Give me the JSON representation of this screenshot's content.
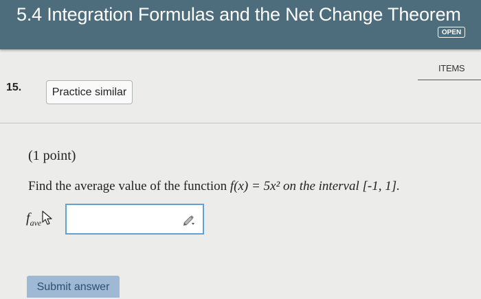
{
  "header": {
    "title": "5.4 Integration Formulas and the Net Change Theorem",
    "badge": "OPEN"
  },
  "nav": {
    "items_label": "ITEMS"
  },
  "question": {
    "number": "15.",
    "practice_label": "Practice similar",
    "points": "(1 point)",
    "text_before": "Find the average value of the function ",
    "function_expr": "f(x) = 5x² on the interval [-1, 1].",
    "answer_label_f": "f",
    "answer_label_sub": "ave",
    "answer_label_eq": "=",
    "answer_value": ""
  },
  "submit": {
    "label": "Submit answer"
  },
  "icons": {
    "pencil": "pencil-icon",
    "cursor": "mouse-cursor-icon"
  },
  "colors": {
    "header_bg": "#4d6d7d",
    "input_border": "#5da1d6",
    "submit_bg": "#9fb8d3"
  }
}
